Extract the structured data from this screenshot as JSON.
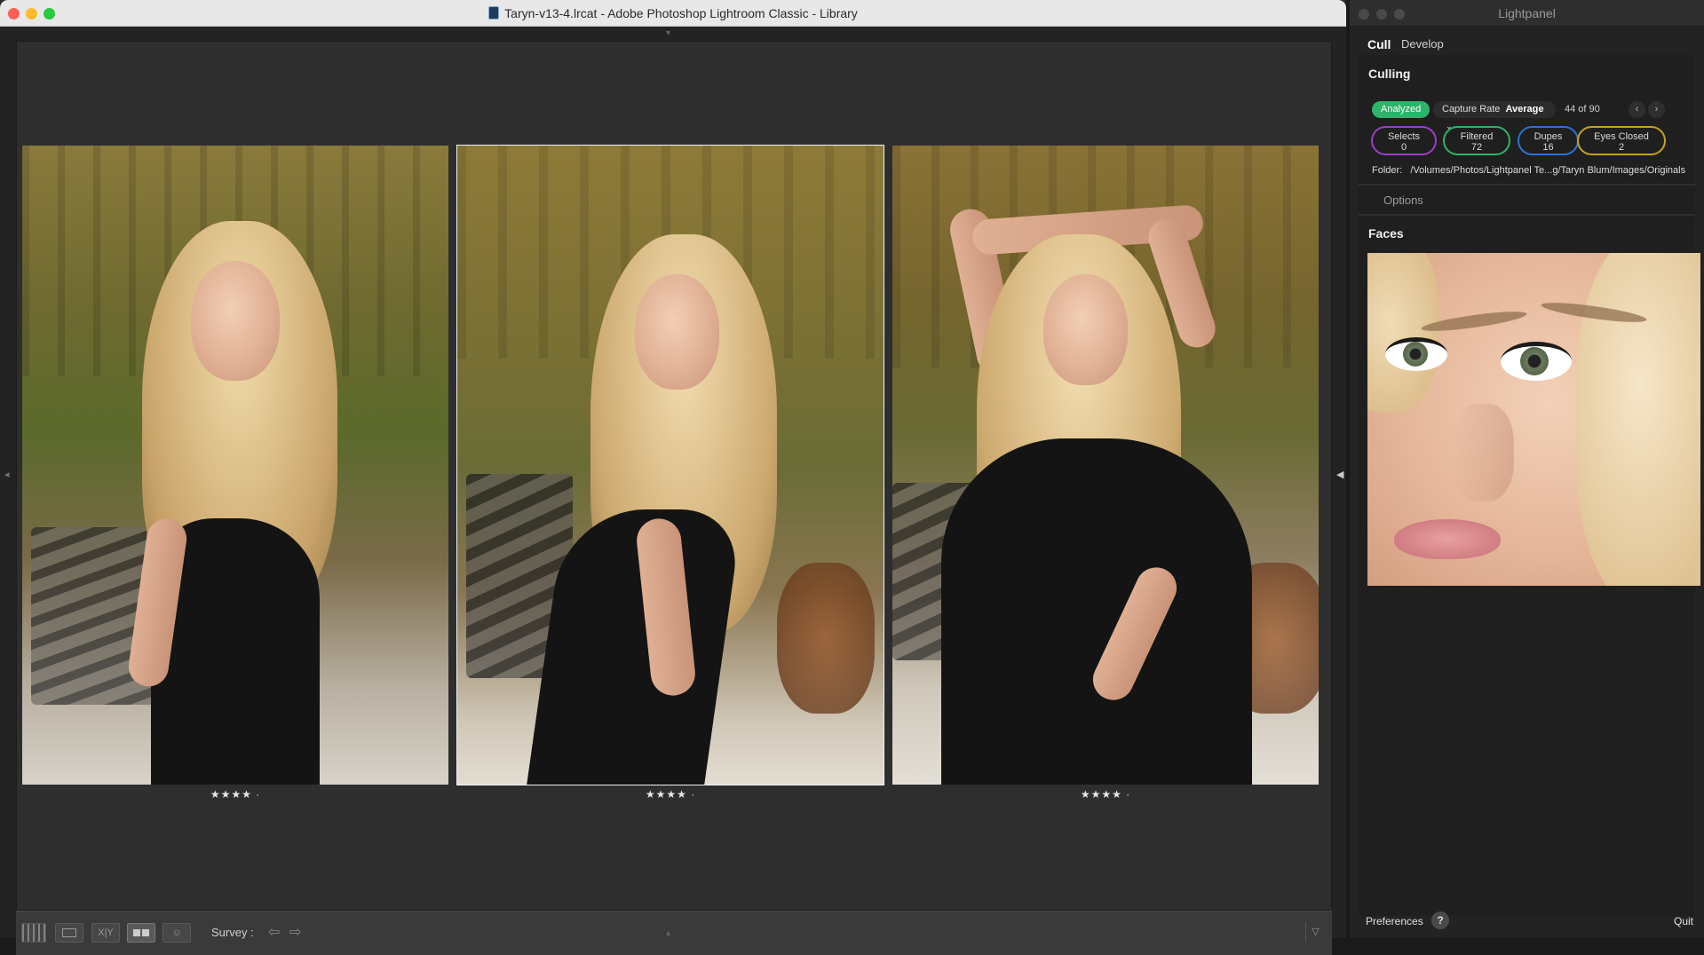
{
  "lightroom": {
    "window_title": "Taryn-v13-4.lrcat - Adobe Photoshop Lightroom Classic - Library",
    "photos": [
      {
        "rating": "★★★★ ·",
        "selected": false
      },
      {
        "rating": "★★★★ ·",
        "selected": true
      },
      {
        "rating": "★★★★ ·",
        "selected": false
      }
    ],
    "toolbar": {
      "survey_label": "Survey :",
      "view_buttons": [
        "grid-view-icon",
        "loupe-view-icon",
        "compare-view-icon",
        "survey-view-icon",
        "people-view-icon"
      ],
      "compare_text": "X|Y"
    }
  },
  "lightpanel": {
    "title": "Lightpanel",
    "tabs": [
      "Cull",
      "Develop"
    ],
    "culling": {
      "heading": "Culling",
      "status": "Analyzed",
      "capture_rate_label": "Capture Rate",
      "capture_rate_value": "Average",
      "count_text": "44 of 90",
      "stats": [
        {
          "label": "Selects",
          "value": "0",
          "color": "#9b3fc9"
        },
        {
          "label": "Filtered",
          "value": "72",
          "color": "#2fb36a"
        },
        {
          "label": "Dupes",
          "value": "16",
          "color": "#2f72d6"
        },
        {
          "label": "Eyes Closed",
          "value": "2",
          "color": "#c9a11f"
        }
      ],
      "folder_label": "Folder:",
      "folder_path": "/Volumes/Photos/Lightpanel Te...g/Taryn Blum/Images/Originals"
    },
    "options_label": "Options",
    "faces_heading": "Faces",
    "footer": {
      "preferences": "Preferences",
      "help": "?",
      "quit": "Quit"
    }
  }
}
